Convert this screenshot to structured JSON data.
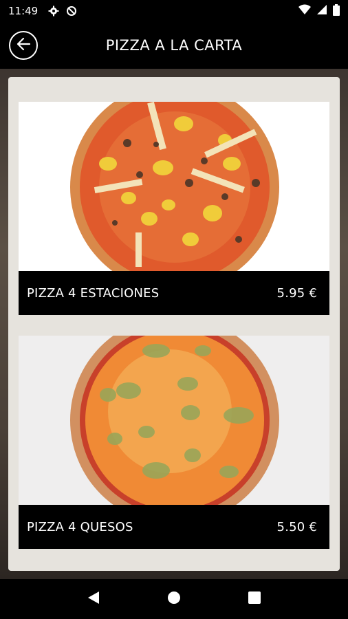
{
  "status_bar": {
    "time": "11:49",
    "icons": [
      "gear-icon",
      "no-sync-icon",
      "wifi-icon",
      "signal-icon",
      "battery-icon"
    ]
  },
  "app_bar": {
    "title": "PIZZA A LA CARTA",
    "back_icon": "back-arrow-icon"
  },
  "menu": {
    "items": [
      {
        "name": "PIZZA 4 ESTACIONES",
        "price": "5.95 €"
      },
      {
        "name": "PIZZA 4 QUESOS",
        "price": "5.50 €"
      }
    ]
  },
  "nav_bar": {
    "icons": [
      "back-triangle-icon",
      "home-circle-icon",
      "recents-square-icon"
    ]
  },
  "colors": {
    "bar_background": "#000000",
    "panel_background": "#e6e3dd",
    "text": "#ffffff"
  }
}
